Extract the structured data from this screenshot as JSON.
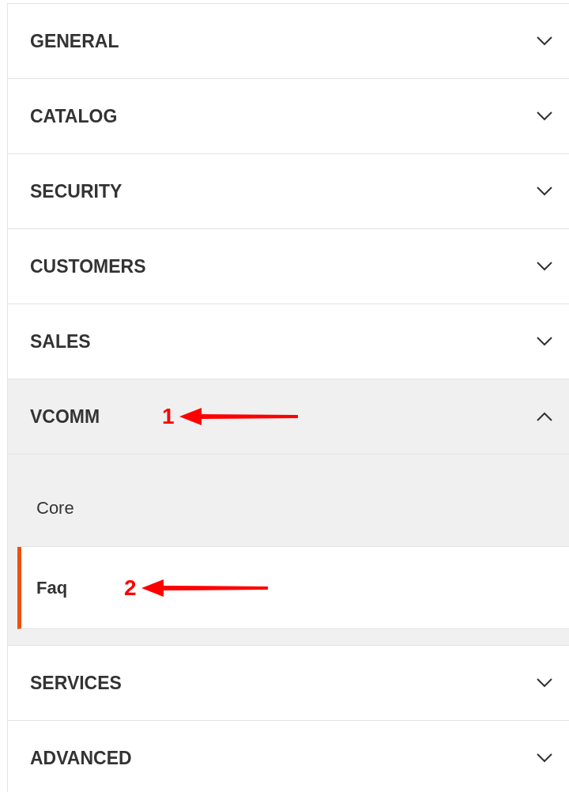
{
  "sections": [
    {
      "title": "GENERAL",
      "expanded": false
    },
    {
      "title": "CATALOG",
      "expanded": false
    },
    {
      "title": "SECURITY",
      "expanded": false
    },
    {
      "title": "CUSTOMERS",
      "expanded": false
    },
    {
      "title": "SALES",
      "expanded": false
    },
    {
      "title": "VCOMM",
      "expanded": true,
      "annotation": "1",
      "children": [
        {
          "label": "Core",
          "selected": false
        },
        {
          "label": "Faq",
          "selected": true,
          "annotation": "2"
        }
      ]
    },
    {
      "title": "SERVICES",
      "expanded": false
    },
    {
      "title": "ADVANCED",
      "expanded": false
    }
  ]
}
